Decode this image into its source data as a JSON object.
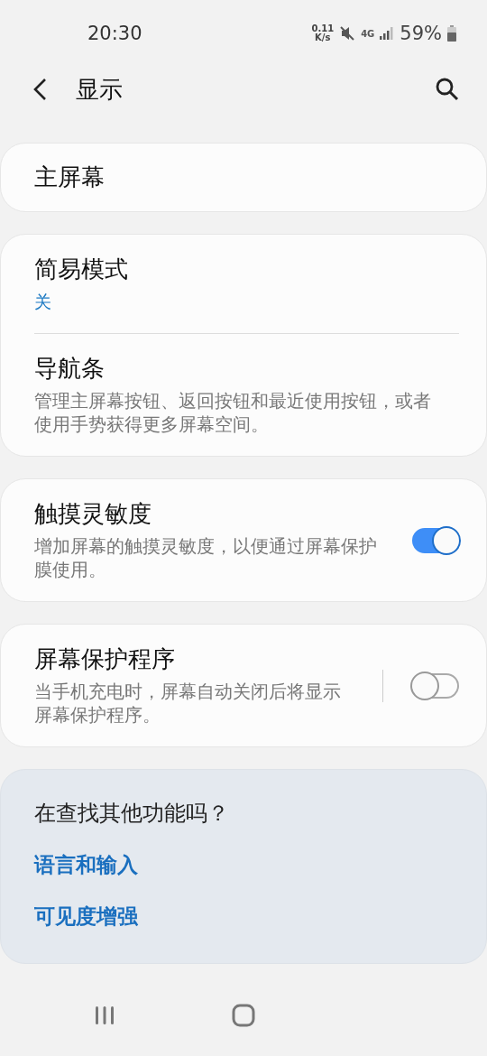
{
  "status_bar": {
    "time": "20:30",
    "net_speed": "0.11",
    "net_unit": "K/s",
    "network": "4G",
    "battery": "59%"
  },
  "header": {
    "title": "显示"
  },
  "groups": [
    {
      "items": [
        {
          "kind": "link",
          "title": "主屏幕"
        }
      ]
    },
    {
      "items": [
        {
          "kind": "value",
          "title": "简易模式",
          "value": "关"
        },
        {
          "kind": "desc",
          "title": "导航条",
          "description": "管理主屏幕按钮、返回按钮和最近使用按钮，或者使用手势获得更多屏幕空间。"
        }
      ]
    },
    {
      "items": [
        {
          "kind": "toggle",
          "title": "触摸灵敏度",
          "description": "增加屏幕的触摸灵敏度，以便通过屏幕保护膜使用。",
          "on": true,
          "divider": false
        }
      ]
    },
    {
      "items": [
        {
          "kind": "toggle",
          "title": "屏幕保护程序",
          "description": "当手机充电时，屏幕自动关闭后将显示屏幕保护程序。",
          "on": false,
          "divider": true
        }
      ]
    }
  ],
  "suggestions": {
    "title": "在查找其他功能吗？",
    "links": [
      "语言和输入",
      "可见度增强"
    ]
  }
}
